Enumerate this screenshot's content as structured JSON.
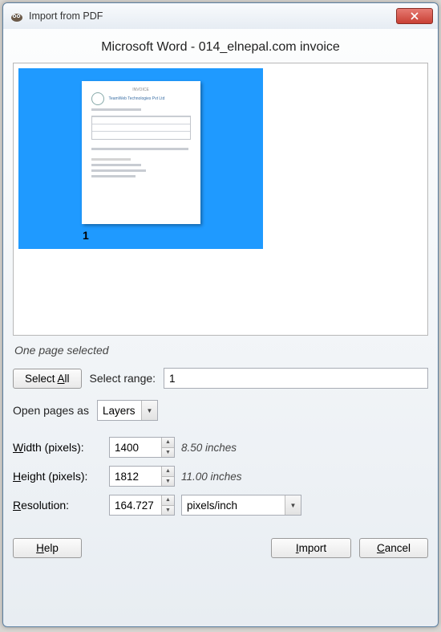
{
  "window": {
    "title": "Import from PDF",
    "icon_name": "gimp-icon"
  },
  "document_title": "Microsoft Word - 014_elnepal.com invoice",
  "preview": {
    "page_number": "1"
  },
  "status_text": "One page selected",
  "select_all_label": "Select All",
  "select_range_label": "Select range:",
  "select_range_value": "1",
  "open_pages_label": "Open pages as",
  "open_pages_value": "Layers",
  "width": {
    "label": "Width (pixels):",
    "value": "1400",
    "hint": "8.50 inches"
  },
  "height": {
    "label": "Height (pixels):",
    "value": "1812",
    "hint": "11.00 inches"
  },
  "resolution": {
    "label": "Resolution:",
    "value": "164.727",
    "unit": "pixels/inch"
  },
  "buttons": {
    "help": "Help",
    "import": "Import",
    "cancel": "Cancel"
  },
  "und": {
    "select_all": "A",
    "width": "W",
    "height": "H",
    "resolution": "R",
    "help": "H",
    "import": "I",
    "cancel": "C"
  }
}
